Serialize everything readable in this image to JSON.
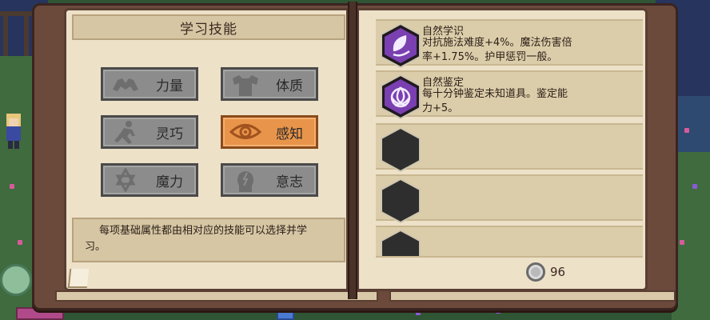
{
  "left_page": {
    "title": "学习技能",
    "attributes": [
      {
        "label": "力量",
        "icon": "strength-arms-icon",
        "selected": false
      },
      {
        "label": "体质",
        "icon": "constitution-torso-icon",
        "selected": false
      },
      {
        "label": "灵巧",
        "icon": "dexterity-runner-icon",
        "selected": false
      },
      {
        "label": "感知",
        "icon": "perception-eye-icon",
        "selected": true
      },
      {
        "label": "魔力",
        "icon": "magic-hexagram-icon",
        "selected": false
      },
      {
        "label": "意志",
        "icon": "willpower-head-icon",
        "selected": false
      }
    ],
    "description_lines": [
      "每项基础属性都由相对应的技能可以选择并学",
      "习。"
    ]
  },
  "right_page": {
    "skills": [
      {
        "name": "自然学识",
        "icon": "nature-leaf-icon",
        "desc_lines": [
          "对抗施法难度+4%。魔法伤害倍",
          "率+1.75%。护甲惩罚一般。"
        ]
      },
      {
        "name": "自然鉴定",
        "icon": "triquetra-knot-icon",
        "desc_lines": [
          "每十分钟鉴定未知道具。鉴定能",
          "力+5。"
        ]
      }
    ],
    "empty_slots": 3,
    "currency": {
      "icon": "silver-coin-icon",
      "amount": "96"
    }
  },
  "colors": {
    "selected": "#e8944a",
    "button": "#8c8c8c",
    "skill_icon": "#7a3fb0",
    "page": "#ede1c8"
  }
}
